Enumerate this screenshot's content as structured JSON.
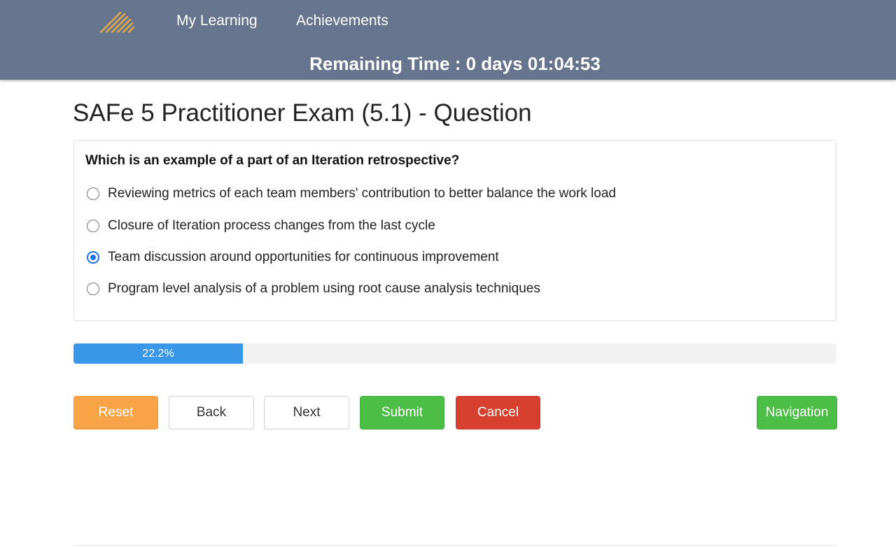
{
  "header": {
    "nav": {
      "my_learning": "My Learning",
      "achievements": "Achievements"
    },
    "remaining_time": "Remaining Time : 0 days 01:04:53",
    "logo_icon": "striped-logo-icon",
    "logo_color": "#e0a84a",
    "bar_color": "#67748d"
  },
  "main": {
    "title": "SAFe 5 Practitioner Exam (5.1) - Question",
    "question": "Which is an example of a part of an Iteration retrospective?",
    "options": [
      {
        "label": "Reviewing metrics of each team members' contribution to better balance the work load",
        "selected": false
      },
      {
        "label": "Closure of Iteration process changes from the last cycle",
        "selected": false
      },
      {
        "label": "Team discussion around opportunities for continuous improvement",
        "selected": true
      },
      {
        "label": "Program level analysis of a problem using root cause analysis techniques",
        "selected": false
      }
    ],
    "progress": {
      "percent": 22.2,
      "label": "22.2%",
      "color": "#3a96e8"
    }
  },
  "buttons": {
    "reset": "Reset",
    "back": "Back",
    "next": "Next",
    "submit": "Submit",
    "cancel": "Cancel",
    "navigation": "Navigation"
  },
  "colors": {
    "reset": "#f7a447",
    "submit": "#4cbd45",
    "cancel": "#d7402f",
    "navigation": "#4cbd45",
    "radio_selected": "#1a73e8"
  }
}
